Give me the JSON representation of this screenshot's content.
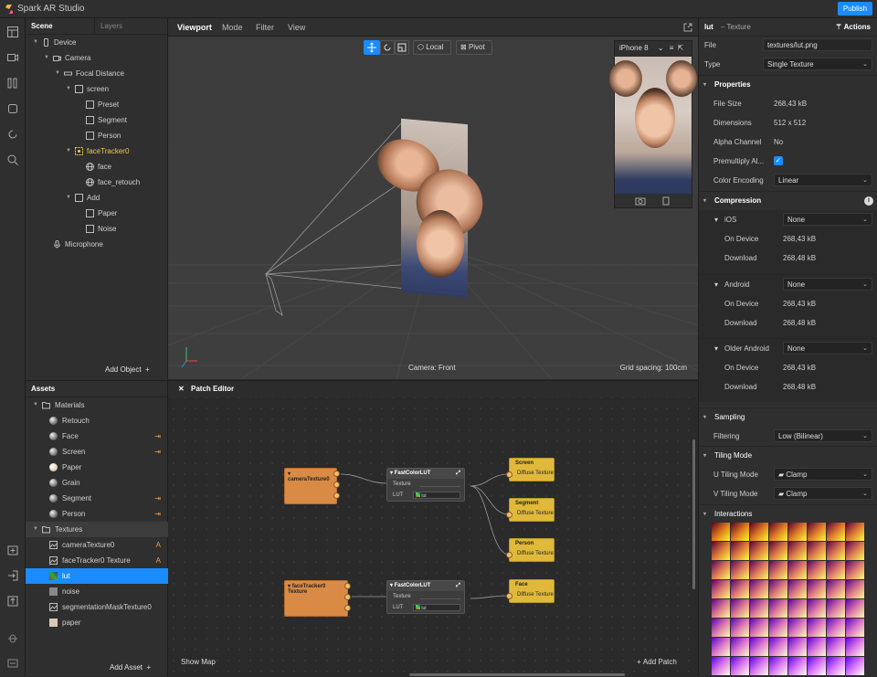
{
  "app": {
    "title": "Spark AR Studio",
    "publish": "Publish"
  },
  "scene": {
    "tabs": [
      "Scene",
      "Layers"
    ],
    "tree": [
      {
        "label": "Device",
        "depth": 0,
        "icon": "device"
      },
      {
        "label": "Camera",
        "depth": 1,
        "icon": "camera"
      },
      {
        "label": "Focal Distance",
        "depth": 2,
        "icon": "focal"
      },
      {
        "label": "screen",
        "depth": 3,
        "icon": "rect"
      },
      {
        "label": "Preset",
        "depth": 4,
        "icon": "rect"
      },
      {
        "label": "Segment",
        "depth": 4,
        "icon": "rect"
      },
      {
        "label": "Person",
        "depth": 4,
        "icon": "rect"
      },
      {
        "label": "faceTracker0",
        "depth": 3,
        "icon": "tracker"
      },
      {
        "label": "face",
        "depth": 4,
        "icon": "mesh"
      },
      {
        "label": "face_retouch",
        "depth": 4,
        "icon": "mesh"
      },
      {
        "label": "Add",
        "depth": 3,
        "icon": "rect"
      },
      {
        "label": "Paper",
        "depth": 4,
        "icon": "rect"
      },
      {
        "label": "Noise",
        "depth": 4,
        "icon": "rect"
      },
      {
        "label": "Microphone",
        "depth": 1,
        "icon": "mic"
      }
    ],
    "add_object": "Add Object"
  },
  "assets": {
    "header": "Assets",
    "materials_label": "Materials",
    "materials": [
      {
        "label": "Retouch",
        "badge": ""
      },
      {
        "label": "Face",
        "badge": "⇥"
      },
      {
        "label": "Screen",
        "badge": "⇥"
      },
      {
        "label": "Paper",
        "badge": ""
      },
      {
        "label": "Grain",
        "badge": ""
      },
      {
        "label": "Segment",
        "badge": "⇥"
      },
      {
        "label": "Person",
        "badge": "⇥"
      }
    ],
    "textures_label": "Textures",
    "textures": [
      {
        "label": "cameraTexture0",
        "badge": "A"
      },
      {
        "label": "faceTracker0 Texture",
        "badge": "A"
      },
      {
        "label": "lut",
        "badge": ""
      },
      {
        "label": "noise",
        "badge": ""
      },
      {
        "label": "segmentationMaskTexture0",
        "badge": ""
      },
      {
        "label": "paper",
        "badge": ""
      }
    ],
    "add_asset": "Add Asset"
  },
  "viewport": {
    "tabs": [
      "Viewport",
      "Mode",
      "Filter",
      "View"
    ],
    "local": "Local",
    "pivot": "Pivot",
    "device": "iPhone 8",
    "camera_label": "Camera: Front",
    "grid_label": "Grid spacing: 100cm"
  },
  "patch_editor": {
    "title": "Patch Editor",
    "show_map": "Show Map",
    "add_patch": "Add Patch",
    "nodes": {
      "cam": "cameraTexture0",
      "ft": "faceTracker0 Texture",
      "lut1": "FastColorLUT",
      "lut2": "FastColorLUT",
      "texture": "Texture",
      "lut": "LUT",
      "lut_val": "lut",
      "screen": "Screen",
      "segment": "Segment",
      "person": "Person",
      "face": "Face",
      "diffuse": "Diffuse Texture"
    }
  },
  "inspector": {
    "title": "lut",
    "subtitle": "– Texture",
    "actions": "Actions",
    "file_label": "File",
    "file_value": "textures/lut.png",
    "type_label": "Type",
    "type_value": "Single Texture",
    "properties_label": "Properties",
    "file_size_label": "File Size",
    "file_size": "268,43 kB",
    "dimensions_label": "Dimensions",
    "dimensions": "512 x 512",
    "alpha_label": "Alpha Channel",
    "alpha": "No",
    "premult_label": "Premultiply Al...",
    "premult_checked": true,
    "color_enc_label": "Color Encoding",
    "color_enc": "Linear",
    "compression_label": "Compression",
    "platforms": [
      {
        "name": "iOS",
        "value": "None",
        "on_device": "268,43 kB",
        "download": "268,48 kB"
      },
      {
        "name": "Android",
        "value": "None",
        "on_device": "268,43 kB",
        "download": "268,48 kB"
      },
      {
        "name": "Older Android",
        "value": "None",
        "on_device": "268,43 kB",
        "download": "268,48 kB"
      }
    ],
    "on_device_label": "On Device",
    "download_label": "Download",
    "sampling_label": "Sampling",
    "filtering_label": "Filtering",
    "filtering": "Low (Bilinear)",
    "tiling_label": "Tiling Mode",
    "u_tiling_label": "U Tiling Mode",
    "u_tiling": "Clamp",
    "v_tiling_label": "V Tiling Mode",
    "v_tiling": "Clamp",
    "interactions_label": "Interactions"
  },
  "colors": {
    "accent": "#1a8cff",
    "orange": "#d98a45",
    "yellow": "#e0b93b",
    "highlight": "#f2c94c"
  }
}
